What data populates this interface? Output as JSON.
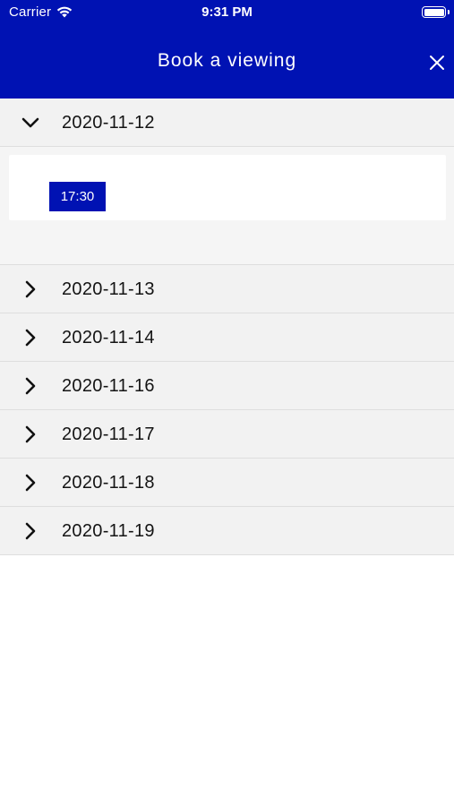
{
  "status_bar": {
    "carrier": "Carrier",
    "time": "9:31 PM",
    "wifi_icon": "wifi-icon",
    "battery_icon": "battery-icon"
  },
  "nav": {
    "title": "Book a viewing",
    "close_icon": "close-icon",
    "background_color": "#0012b3"
  },
  "dates": [
    {
      "label": "2020-11-12",
      "expanded": true,
      "slots": [
        "17:30"
      ]
    },
    {
      "label": "2020-11-13",
      "expanded": false
    },
    {
      "label": "2020-11-14",
      "expanded": false
    },
    {
      "label": "2020-11-16",
      "expanded": false
    },
    {
      "label": "2020-11-17",
      "expanded": false
    },
    {
      "label": "2020-11-18",
      "expanded": false
    },
    {
      "label": "2020-11-19",
      "expanded": false
    }
  ],
  "colors": {
    "accent": "#0012b3",
    "row_background": "#f2f2f2"
  }
}
